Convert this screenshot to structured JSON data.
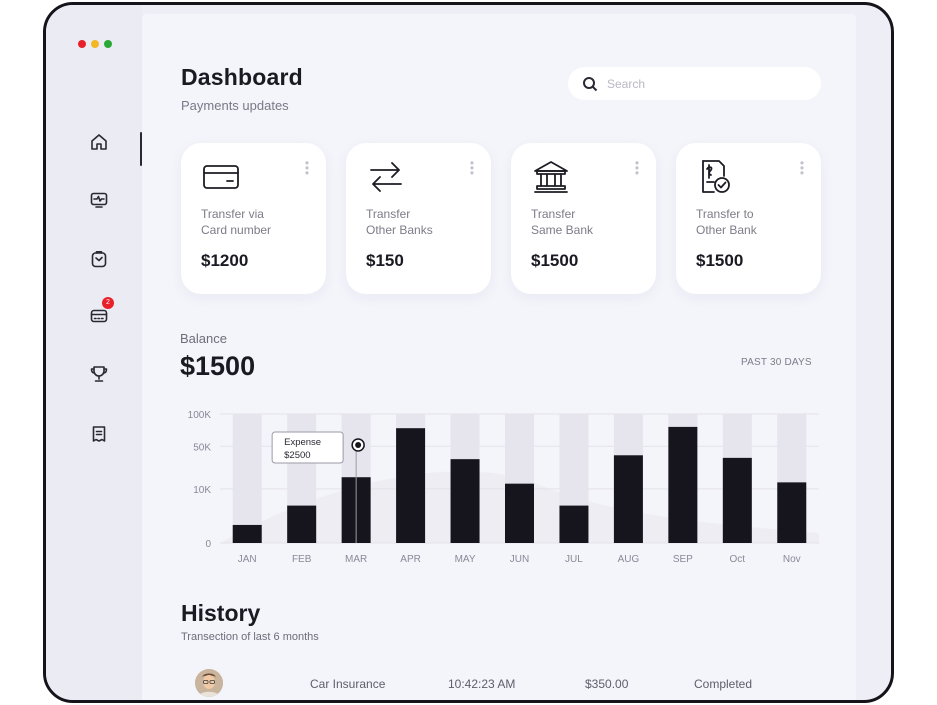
{
  "window": {
    "dots": [
      {
        "color": "#e8202a",
        "name": "close-dot"
      },
      {
        "color": "#f3b624",
        "name": "minimize-dot"
      },
      {
        "color": "#2aa836",
        "name": "maximize-dot"
      }
    ]
  },
  "sidebar": {
    "items": [
      {
        "icon": "home-icon",
        "active": true
      },
      {
        "icon": "monitor-icon"
      },
      {
        "icon": "clipboard-icon"
      },
      {
        "icon": "card-icon",
        "badge": "2"
      },
      {
        "icon": "trophy-icon"
      },
      {
        "icon": "receipt-icon"
      }
    ]
  },
  "header": {
    "title": "Dashboard",
    "subtitle": "Payments updates",
    "search_placeholder": "Search"
  },
  "cards": [
    {
      "icon": "credit-card-icon",
      "line1": "Transfer via",
      "line2": "Card number",
      "amount": "$1200"
    },
    {
      "icon": "transfer-arrows-icon",
      "line1": "Transfer",
      "line2": "Other Banks",
      "amount": "$150"
    },
    {
      "icon": "bank-icon",
      "line1": "Transfer",
      "line2": "Same Bank",
      "amount": "$1500"
    },
    {
      "icon": "document-check-icon",
      "line1": "Transfer to",
      "line2": "Other Bank",
      "amount": "$1500"
    }
  ],
  "balance": {
    "label": "Balance",
    "amount": "$1500",
    "period": "PAST 30 DAYS"
  },
  "chart_data": {
    "type": "bar",
    "categories": [
      "JAN",
      "FEB",
      "MAR",
      "APR",
      "MAY",
      "JUN",
      "JUL",
      "AUG",
      "SEP",
      "Oct",
      "Nov"
    ],
    "y_tick_labels": [
      "100K",
      "50K",
      "10K",
      "0"
    ],
    "values": [
      14,
      29,
      51,
      89,
      65,
      46,
      29,
      68,
      90,
      66,
      47
    ],
    "background_max": 100,
    "tooltip": {
      "category": "MAR",
      "label": "Expense",
      "value": "$2500"
    },
    "colors": {
      "bar": "#16151d",
      "track": "#e6e5ee"
    }
  },
  "history": {
    "title": "History",
    "subtitle": "Transection of last 6 months",
    "rows": [
      {
        "name": "Car Insurance",
        "time": "10:42:23 AM",
        "amount": "$350.00",
        "status": "Completed"
      }
    ]
  }
}
